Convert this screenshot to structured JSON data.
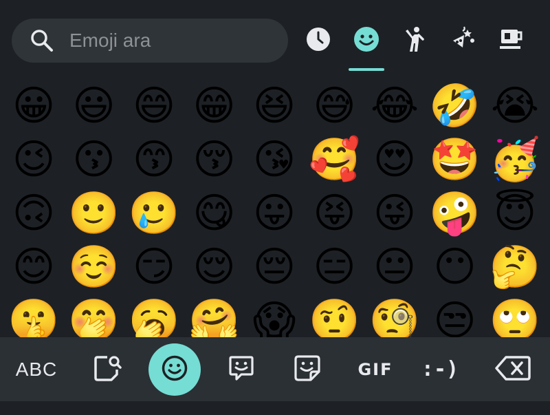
{
  "search": {
    "placeholder": "Emoji ara"
  },
  "categories": [
    {
      "name": "recent",
      "icon": "clock-icon",
      "active": false
    },
    {
      "name": "smileys",
      "icon": "smiley-icon",
      "active": true
    },
    {
      "name": "people",
      "icon": "person-icon",
      "active": false
    },
    {
      "name": "activities",
      "icon": "party-icon",
      "active": false
    },
    {
      "name": "food",
      "icon": "cup-icon",
      "active": false
    }
  ],
  "emoji_rows": [
    [
      "😀",
      "😃",
      "😄",
      "😁",
      "😆",
      "😅",
      "😂",
      "🤣",
      "😭"
    ],
    [
      "😉",
      "😗",
      "😙",
      "😚",
      "😘",
      "🥰",
      "😍",
      "🤩",
      "🥳"
    ],
    [
      "🙃",
      "🙂",
      "🥲",
      "😋",
      "😛",
      "😝",
      "😜",
      "🤪",
      "😇"
    ],
    [
      "😊",
      "☺️",
      "😏",
      "😌",
      "😔",
      "😑",
      "😐",
      "😶",
      "🤔"
    ],
    [
      "🤫",
      "🤭",
      "🥱",
      "🤗",
      "😱",
      "🤨",
      "🧐",
      "😒",
      "🙄"
    ]
  ],
  "bottom_bar": {
    "abc_label": "ABC",
    "gif_label": "GIF",
    "emoticon_label": ":-)"
  },
  "colors": {
    "accent": "#75ddd4",
    "background": "#1d2125",
    "search_bg": "#2f3438",
    "bar_bg": "#2b3035",
    "icon": "#e8eaed"
  }
}
